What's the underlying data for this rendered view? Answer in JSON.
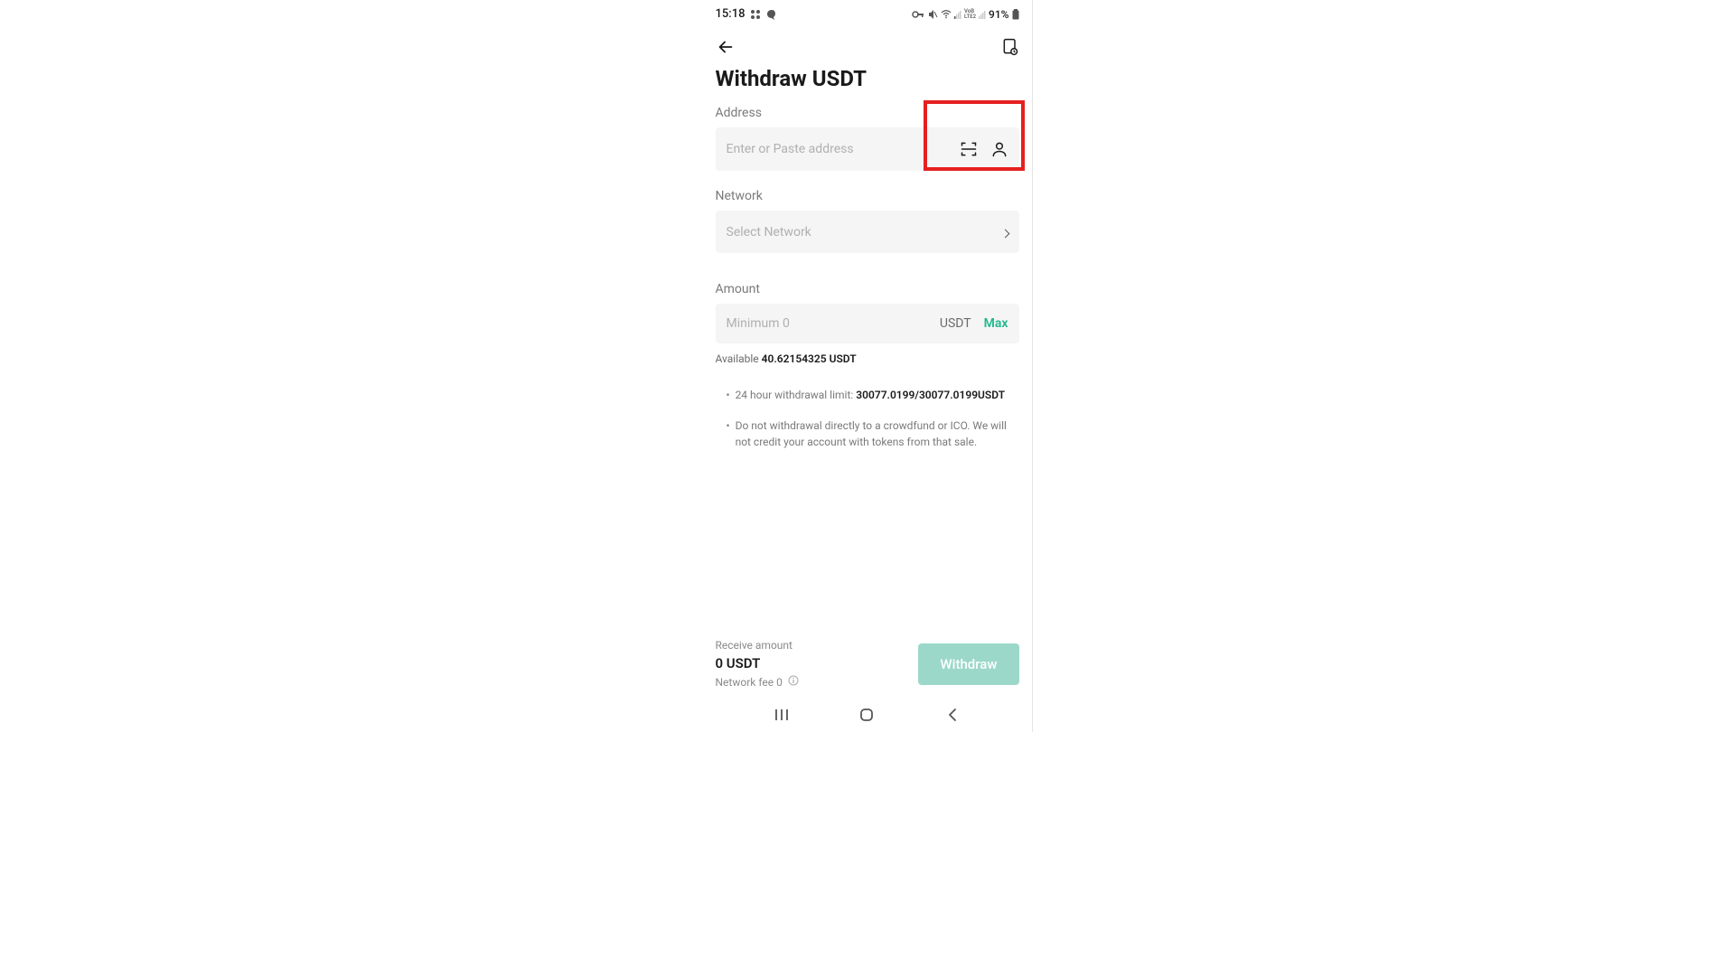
{
  "status": {
    "time": "15:18",
    "battery": "91%"
  },
  "page": {
    "title": "Withdraw USDT"
  },
  "address": {
    "label": "Address",
    "placeholder": "Enter or Paste address"
  },
  "network": {
    "label": "Network",
    "placeholder": "Select Network"
  },
  "amount": {
    "label": "Amount",
    "placeholder": "Minimum 0",
    "unit": "USDT",
    "max_label": "Max",
    "available_label": "Available",
    "available_value": "40.62154325 USDT"
  },
  "notes": {
    "limit_label": "24 hour withdrawal limit: ",
    "limit_value": "30077.0199/30077.0199USDT",
    "warning": "Do not withdrawal directly to a crowdfund or ICO. We will not credit your account with tokens from that sale."
  },
  "bottom": {
    "receive_label": "Receive amount",
    "receive_value": "0 USDT",
    "fee_label": "Network fee 0",
    "withdraw_label": "Withdraw"
  }
}
